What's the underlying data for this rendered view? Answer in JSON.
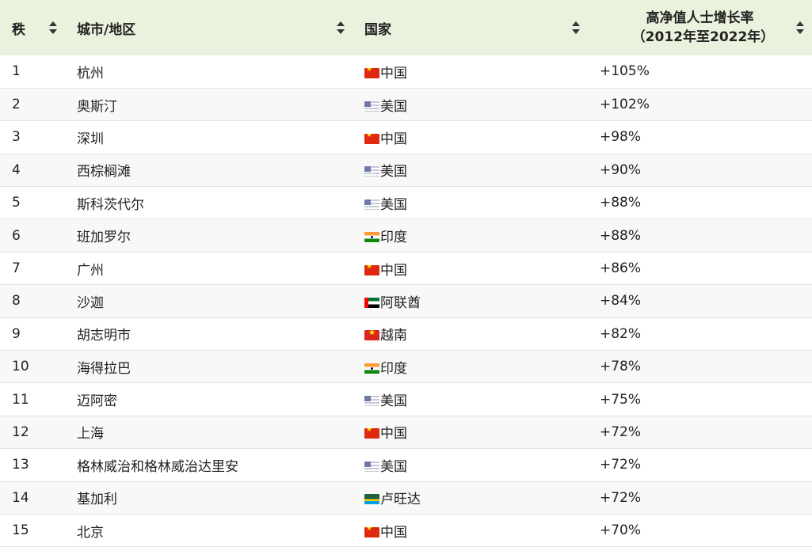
{
  "table": {
    "headers": {
      "rank": "秩",
      "city": "城市/地区",
      "country": "国家",
      "growth_line1": "高净值人士增长率",
      "growth_line2": "（2012年至2022年）"
    },
    "rows": [
      {
        "rank": "1",
        "city": "杭州",
        "country": "中国",
        "flag": "cn",
        "growth": "+105%"
      },
      {
        "rank": "2",
        "city": "奥斯汀",
        "country": "美国",
        "flag": "us",
        "growth": "+102%"
      },
      {
        "rank": "3",
        "city": "深圳",
        "country": "中国",
        "flag": "cn",
        "growth": "+98%"
      },
      {
        "rank": "4",
        "city": "西棕榈滩",
        "country": "美国",
        "flag": "us",
        "growth": "+90%"
      },
      {
        "rank": "5",
        "city": "斯科茨代尔",
        "country": "美国",
        "flag": "us",
        "growth": "+88%"
      },
      {
        "rank": "6",
        "city": "班加罗尔",
        "country": "印度",
        "flag": "in",
        "growth": "+88%"
      },
      {
        "rank": "7",
        "city": "广州",
        "country": "中国",
        "flag": "cn",
        "growth": "+86%"
      },
      {
        "rank": "8",
        "city": "沙迦",
        "country": "阿联酋",
        "flag": "ae",
        "growth": "+84%"
      },
      {
        "rank": "9",
        "city": "胡志明市",
        "country": "越南",
        "flag": "vn",
        "growth": "+82%"
      },
      {
        "rank": "10",
        "city": "海得拉巴",
        "country": "印度",
        "flag": "in",
        "growth": "+78%"
      },
      {
        "rank": "11",
        "city": "迈阿密",
        "country": "美国",
        "flag": "us",
        "growth": "+75%"
      },
      {
        "rank": "12",
        "city": "上海",
        "country": "中国",
        "flag": "cn",
        "growth": "+72%"
      },
      {
        "rank": "13",
        "city": "格林威治和格林威治达里安",
        "country": "美国",
        "flag": "us",
        "growth": "+72%"
      },
      {
        "rank": "14",
        "city": "基加利",
        "country": "卢旺达",
        "flag": "rw",
        "growth": "+72%"
      },
      {
        "rank": "15",
        "city": "北京",
        "country": "中国",
        "flag": "cn",
        "growth": "+70%"
      }
    ]
  }
}
